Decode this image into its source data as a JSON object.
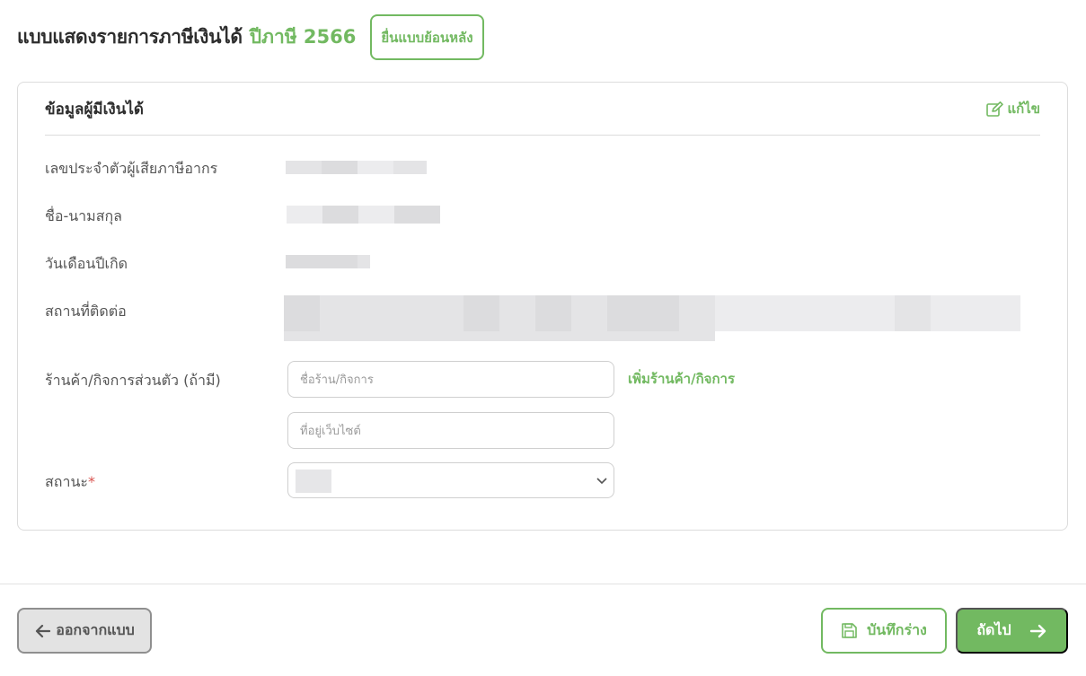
{
  "colors": {
    "accent": "#72b961"
  },
  "header": {
    "title": "แบบแสดงรายการภาษีเงินได้",
    "tax_year": "ปีภาษี 2566",
    "late_filing_button": "ยื่นแบบย้อนหลัง"
  },
  "card": {
    "title": "ข้อมูลผู้มีเงินได้",
    "edit_label": "แก้ไข",
    "edit_icon": "edit-icon",
    "rows": {
      "tax_id_label": "เลขประจำตัวผู้เสียภาษีอากร",
      "name_label": "ชื่อ-นามสกุล",
      "birthdate_label": "วันเดือนปีเกิด",
      "address_label": "สถานที่ติดต่อ",
      "shop_label": "ร้านค้า/กิจการส่วนตัว (ถ้ามี)",
      "status_label": "สถานะ",
      "required_mark": "*"
    },
    "shop_name_placeholder": "ชื่อร้าน/กิจการ",
    "website_placeholder": "ที่อยู่เว็บไซต์",
    "add_shop_link": "เพิ่มร้านค้า/กิจการ"
  },
  "footer": {
    "exit_button": "ออกจากแบบ",
    "save_draft_button": "บันทึกร่าง",
    "next_button": "ถัดไป"
  }
}
